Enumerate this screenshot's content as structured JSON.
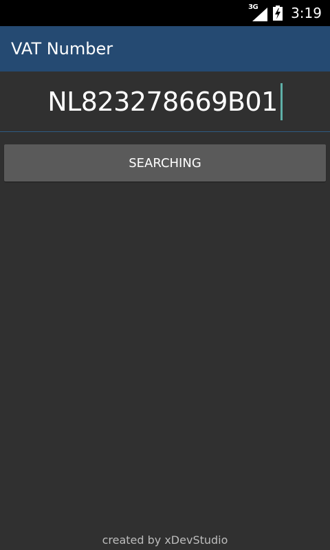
{
  "status_bar": {
    "network_type": "3G",
    "signal_icon": "cellular-signal-icon",
    "battery_icon": "battery-charging-icon",
    "time": "3:19"
  },
  "app_bar": {
    "title": "VAT Number",
    "background_color": "#254a72"
  },
  "input": {
    "value": "NL823278669B01"
  },
  "button": {
    "label": "SEARCHING"
  },
  "footer": {
    "text": "created by xDevStudio"
  }
}
